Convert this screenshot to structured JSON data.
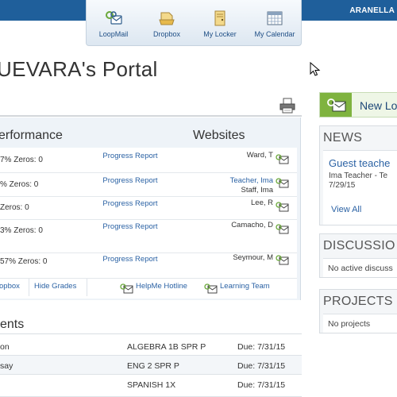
{
  "header": {
    "user_name": "ARANELLA"
  },
  "toolbar": {
    "items": [
      {
        "label": "LoopMail",
        "icon": "loopmail-icon"
      },
      {
        "label": "Dropbox",
        "icon": "dropbox-icon"
      },
      {
        "label": "My Locker",
        "icon": "locker-icon"
      },
      {
        "label": "My Calendar",
        "icon": "calendar-icon"
      }
    ]
  },
  "page": {
    "title": "UEVARA's Portal"
  },
  "performance": {
    "heading": "erformance",
    "websites_heading": "Websites",
    "rows": [
      {
        "stats": "7%  Zeros: 0",
        "report": "Progress Report",
        "teacher": "Ward, T",
        "teacher_link": "",
        "teacher_sub": ""
      },
      {
        "stats": "%  Zeros: 0",
        "report": "Progress Report",
        "teacher": "",
        "teacher_link": "Teacher, Ima",
        "teacher_sub": "Staff, Ima"
      },
      {
        "stats": "  Zeros: 0",
        "report": "Progress Report",
        "teacher": "Lee, R",
        "teacher_link": "",
        "teacher_sub": ""
      },
      {
        "stats": "3%  Zeros: 0",
        "report": "Progress Report",
        "teacher": "Camacho, D",
        "teacher_link": "",
        "teacher_sub": ""
      },
      {
        "stats": "57%  Zeros: 0",
        "report": "Progress Report",
        "teacher": "Seymour, M",
        "teacher_link": "",
        "teacher_sub": ""
      }
    ],
    "links": {
      "dropbox": "opbox",
      "hide_grades": "Hide Grades",
      "helpme": "HelpMe Hotline",
      "learning_team": "Learning Team"
    }
  },
  "assignments": {
    "heading": "ents",
    "rows": [
      {
        "name": "on",
        "class": "ALGEBRA 1B SPR P",
        "due": "Due: 7/31/15"
      },
      {
        "name": "say",
        "class": "ENG 2 SPR P",
        "due": "Due: 7/31/15"
      },
      {
        "name": "",
        "class": "SPANISH 1X",
        "due": "Due: 7/31/15"
      }
    ]
  },
  "sidebar": {
    "new_look": "New Lo",
    "news": {
      "heading": "NEWS",
      "item_title": "Guest teache",
      "item_author": "Ima Teacher - Te",
      "item_date": "7/29/15",
      "view_all": "View All"
    },
    "discussions": {
      "heading": "DISCUSSIO",
      "message": "No active discuss"
    },
    "projects": {
      "heading": "PROJECTS",
      "message": "No projects"
    }
  },
  "colors": {
    "header_bar": "#1f5f9b",
    "link": "#2b62a4",
    "new_look_accent": "#7fb33f",
    "panel_background": "#eef3f8"
  }
}
